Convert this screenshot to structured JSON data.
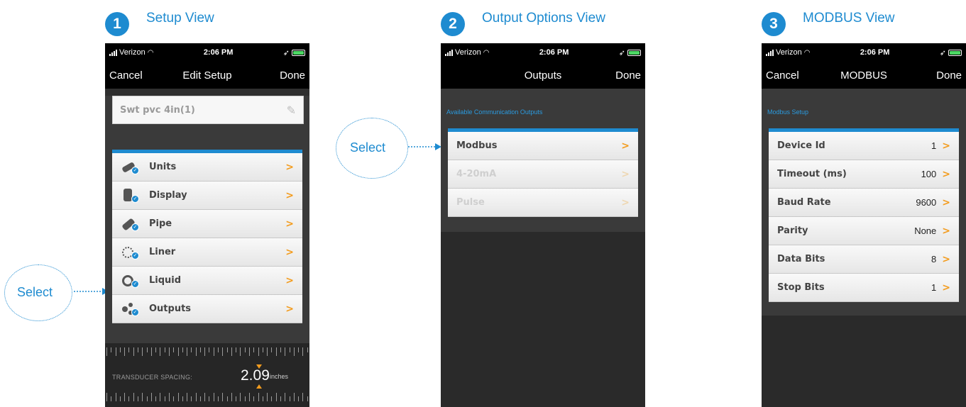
{
  "steps": [
    {
      "number": "1",
      "title": "Setup View"
    },
    {
      "number": "2",
      "title": "Output Options View"
    },
    {
      "number": "3",
      "title": "MODBUS View"
    }
  ],
  "status_bar": {
    "carrier": "Verizon",
    "time": "2:06 PM"
  },
  "setup": {
    "nav": {
      "left": "Cancel",
      "title": "Edit Setup",
      "right": "Done"
    },
    "name_field_value": "Swt pvc 4in(1)",
    "items": [
      {
        "label": "Units",
        "icon": "units-icon"
      },
      {
        "label": "Display",
        "icon": "display-icon"
      },
      {
        "label": "Pipe",
        "icon": "pipe-icon"
      },
      {
        "label": "Liner",
        "icon": "liner-icon"
      },
      {
        "label": "Liquid",
        "icon": "liquid-icon"
      },
      {
        "label": "Outputs",
        "icon": "outputs-icon"
      }
    ],
    "chevron": ">",
    "transducer": {
      "label": "TRANSDUCER SPACING:",
      "value": "2.09",
      "unit": "inches"
    }
  },
  "outputs": {
    "nav": {
      "left": "",
      "title": "Outputs",
      "right": "Done"
    },
    "section": "Available Communication Outputs",
    "items": [
      {
        "label": "Modbus",
        "enabled": true
      },
      {
        "label": "4-20mA",
        "enabled": false
      },
      {
        "label": "Pulse",
        "enabled": false
      }
    ]
  },
  "modbus": {
    "nav": {
      "left": "Cancel",
      "title": "MODBUS",
      "right": "Done"
    },
    "section": "Modbus Setup",
    "items": [
      {
        "label": "Device Id",
        "value": "1"
      },
      {
        "label": "Timeout (ms)",
        "value": "100"
      },
      {
        "label": "Baud Rate",
        "value": "9600"
      },
      {
        "label": "Parity",
        "value": "None"
      },
      {
        "label": "Data Bits",
        "value": "8"
      },
      {
        "label": "Stop Bits",
        "value": "1"
      }
    ]
  },
  "callouts": {
    "select_1": "Select",
    "select_2": "Select"
  },
  "colors": {
    "accent": "#1e8bd0",
    "chevron": "#f39c1e",
    "phone_bg": "#2f2f2f"
  }
}
